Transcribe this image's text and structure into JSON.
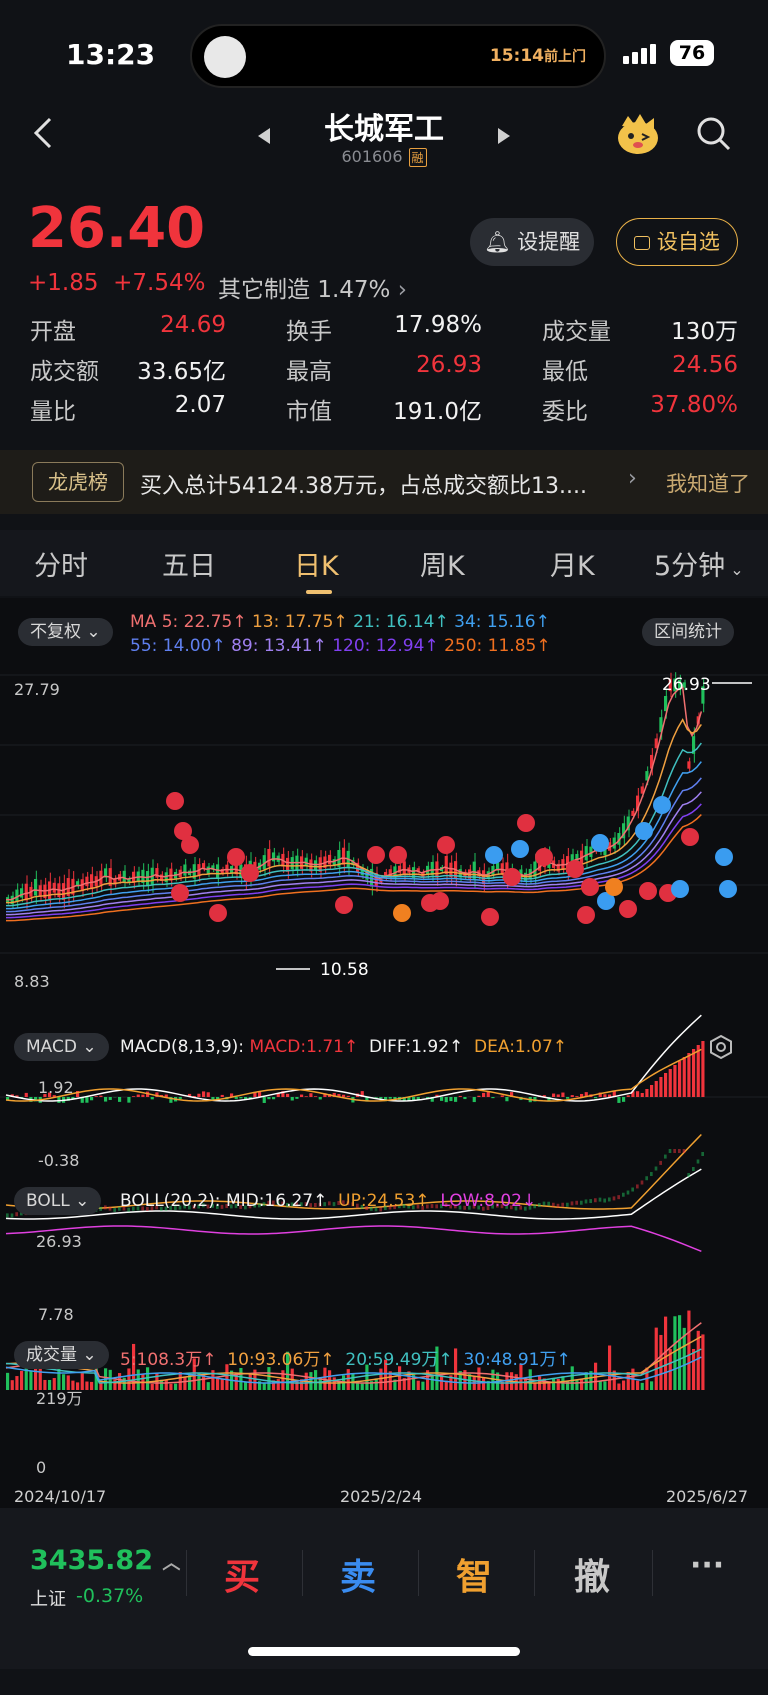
{
  "status": {
    "time": "13:23",
    "island_time": "15:14",
    "island_label": "前上门",
    "battery": "76"
  },
  "header": {
    "title": "长城军工",
    "code": "601606",
    "badge": "融"
  },
  "quote": {
    "price": "26.40",
    "change": "+1.85",
    "change_pct": "+7.54%",
    "sector": "其它制造",
    "sector_pct": "1.47%",
    "remind_label": "设提醒",
    "fav_label": "设自选"
  },
  "stats": [
    {
      "k": "开盘",
      "v": "24.69",
      "c": "red"
    },
    {
      "k": "换手",
      "v": "17.98%",
      "c": "white"
    },
    {
      "k": "成交量",
      "v": "130万",
      "c": "white"
    },
    {
      "k": "成交额",
      "v": "33.65亿",
      "c": "white"
    },
    {
      "k": "最高",
      "v": "26.93",
      "c": "red"
    },
    {
      "k": "最低",
      "v": "24.56",
      "c": "red"
    },
    {
      "k": "量比",
      "v": "2.07",
      "c": "white"
    },
    {
      "k": "市值",
      "v": "191.0亿",
      "c": "white"
    },
    {
      "k": "委比",
      "v": "37.80%",
      "c": "red"
    }
  ],
  "lhb": {
    "tag": "龙虎榜",
    "text": "买入总计54124.38万元，占总成交额比13....",
    "dismiss": "我知道了"
  },
  "tabs": [
    "分时",
    "五日",
    "日K",
    "周K",
    "月K",
    "5分钟"
  ],
  "kline": {
    "adjust_label": "不复权",
    "range_label": "区间统计",
    "ma": [
      {
        "t": "MA 5: 22.75↑",
        "color": "#f07070"
      },
      {
        "t": "13: 17.75↑",
        "color": "#f0a040"
      },
      {
        "t": "21: 16.14↑",
        "color": "#40c0c0"
      },
      {
        "t": "34: 15.16↑",
        "color": "#40a0f0"
      },
      {
        "t": "55: 14.00↑",
        "color": "#6080f0"
      },
      {
        "t": "89: 13.41↑",
        "color": "#a080f0"
      },
      {
        "t": "120: 12.94↑",
        "color": "#8040f0"
      },
      {
        "t": "250: 11.85↑",
        "color": "#f07020"
      }
    ],
    "y_high": "27.79",
    "y_low": "8.83",
    "max_label": "26.93",
    "min_label": "10.58",
    "dates": [
      "2024/10/17",
      "2025/2/24",
      "2025/6/27"
    ]
  },
  "macd": {
    "pill": "MACD",
    "params": "MACD(8,13,9):",
    "macd": "MACD:1.71↑",
    "diff": "DIFF:1.92↑",
    "dea": "DEA:1.07↑",
    "y_high": "1.92",
    "y_low": "-0.38"
  },
  "boll": {
    "pill": "BOLL",
    "params": "BOLL(20,2):",
    "mid": "MID:16.27↑",
    "up": "UP:24.53↑",
    "low": "LOW:8.02↓",
    "y_high": "26.93",
    "y_low": "7.78"
  },
  "volume": {
    "pill": "成交量",
    "v5": "5:108.3万↑",
    "v10": "10:93.06万↑",
    "v20": "20:59.49万↑",
    "v30": "30:48.91万↑",
    "y_high": "219万",
    "y_low": "0"
  },
  "bottom": {
    "index_value": "3435.82",
    "index_name": "上证",
    "index_chg": "-0.37%",
    "buy": "买",
    "sell": "卖",
    "smart": "智",
    "cancel": "撤",
    "more": "···"
  }
}
